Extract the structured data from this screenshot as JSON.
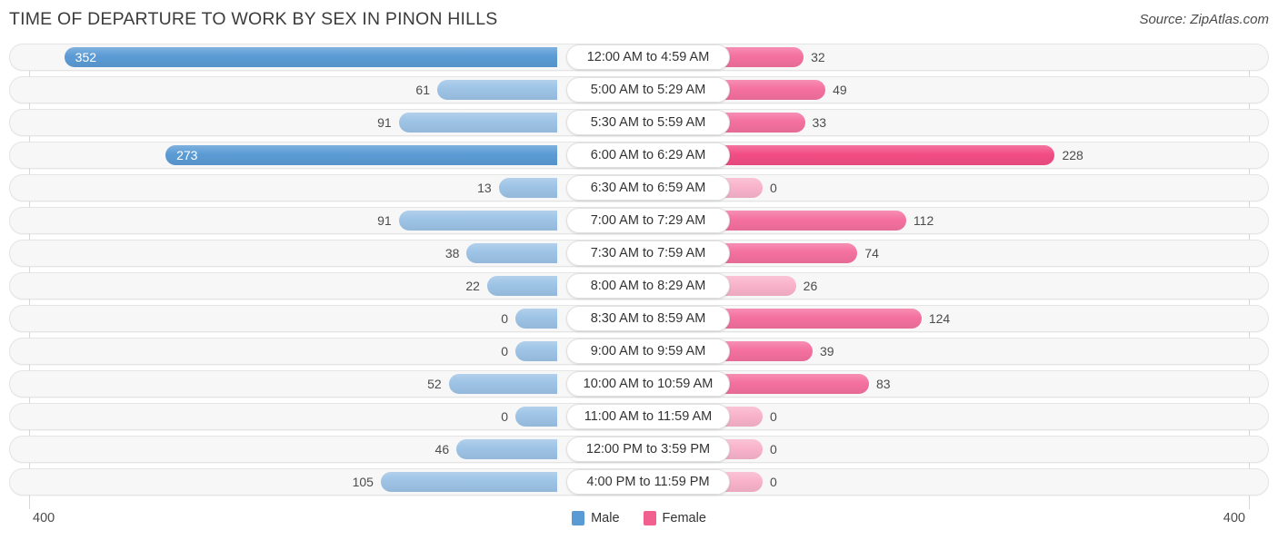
{
  "header": {
    "title": "TIME OF DEPARTURE TO WORK BY SEX IN PINON HILLS",
    "source": "Source: ZipAtlas.com"
  },
  "axis": {
    "left_label": "400",
    "right_label": "400",
    "max": 400
  },
  "legend": {
    "items": [
      {
        "label": "Male",
        "color": "#5b9bd5"
      },
      {
        "label": "Female",
        "color": "#f1618f"
      }
    ]
  },
  "colors": {
    "male_strong": "#5b9bd5",
    "male_light": "#9dc3e6",
    "female_strong": "#f24d84",
    "female_mid": "#f4709f",
    "female_light": "#f9b3cb",
    "track_bg": "#f7f7f7",
    "track_border": "#e4e4e4",
    "gridline": "#d8d8d8",
    "text": "#4c4c4c"
  },
  "chart_data": {
    "type": "bar",
    "title": "TIME OF DEPARTURE TO WORK BY SEX IN PINON HILLS",
    "xlabel": "",
    "ylabel": "",
    "orientation": "horizontal-diverging",
    "xlim": [
      -400,
      400
    ],
    "grid": true,
    "legend_position": "bottom-center",
    "categories": [
      "12:00 AM to 4:59 AM",
      "5:00 AM to 5:29 AM",
      "5:30 AM to 5:59 AM",
      "6:00 AM to 6:29 AM",
      "6:30 AM to 6:59 AM",
      "7:00 AM to 7:29 AM",
      "7:30 AM to 7:59 AM",
      "8:00 AM to 8:29 AM",
      "8:30 AM to 8:59 AM",
      "9:00 AM to 9:59 AM",
      "10:00 AM to 10:59 AM",
      "11:00 AM to 11:59 AM",
      "12:00 PM to 3:59 PM",
      "4:00 PM to 11:59 PM"
    ],
    "series": [
      {
        "name": "Male",
        "color": "#5b9bd5",
        "values": [
          352,
          61,
          91,
          273,
          13,
          91,
          38,
          22,
          0,
          0,
          52,
          0,
          46,
          105
        ]
      },
      {
        "name": "Female",
        "color": "#f1618f",
        "values": [
          32,
          49,
          33,
          228,
          0,
          112,
          74,
          26,
          124,
          39,
          83,
          0,
          0,
          0
        ]
      }
    ]
  },
  "rows": [
    {
      "category": "12:00 AM to 4:59 AM",
      "male": 352,
      "female": 32,
      "male_label": "352",
      "female_label": "32"
    },
    {
      "category": "5:00 AM to 5:29 AM",
      "male": 61,
      "female": 49,
      "male_label": "61",
      "female_label": "49"
    },
    {
      "category": "5:30 AM to 5:59 AM",
      "male": 91,
      "female": 33,
      "male_label": "91",
      "female_label": "33"
    },
    {
      "category": "6:00 AM to 6:29 AM",
      "male": 273,
      "female": 228,
      "male_label": "273",
      "female_label": "228"
    },
    {
      "category": "6:30 AM to 6:59 AM",
      "male": 13,
      "female": 0,
      "male_label": "13",
      "female_label": "0"
    },
    {
      "category": "7:00 AM to 7:29 AM",
      "male": 91,
      "female": 112,
      "male_label": "91",
      "female_label": "112"
    },
    {
      "category": "7:30 AM to 7:59 AM",
      "male": 38,
      "female": 74,
      "male_label": "38",
      "female_label": "74"
    },
    {
      "category": "8:00 AM to 8:29 AM",
      "male": 22,
      "female": 26,
      "male_label": "22",
      "female_label": "26"
    },
    {
      "category": "8:30 AM to 8:59 AM",
      "male": 0,
      "female": 124,
      "male_label": "0",
      "female_label": "124"
    },
    {
      "category": "9:00 AM to 9:59 AM",
      "male": 0,
      "female": 39,
      "male_label": "0",
      "female_label": "39"
    },
    {
      "category": "10:00 AM to 10:59 AM",
      "male": 52,
      "female": 83,
      "male_label": "52",
      "female_label": "83"
    },
    {
      "category": "11:00 AM to 11:59 AM",
      "male": 0,
      "female": 0,
      "male_label": "0",
      "female_label": "0"
    },
    {
      "category": "12:00 PM to 3:59 PM",
      "male": 46,
      "female": 0,
      "male_label": "46",
      "female_label": "0"
    },
    {
      "category": "4:00 PM to 11:59 PM",
      "male": 105,
      "female": 0,
      "male_label": "105",
      "female_label": "0"
    }
  ]
}
